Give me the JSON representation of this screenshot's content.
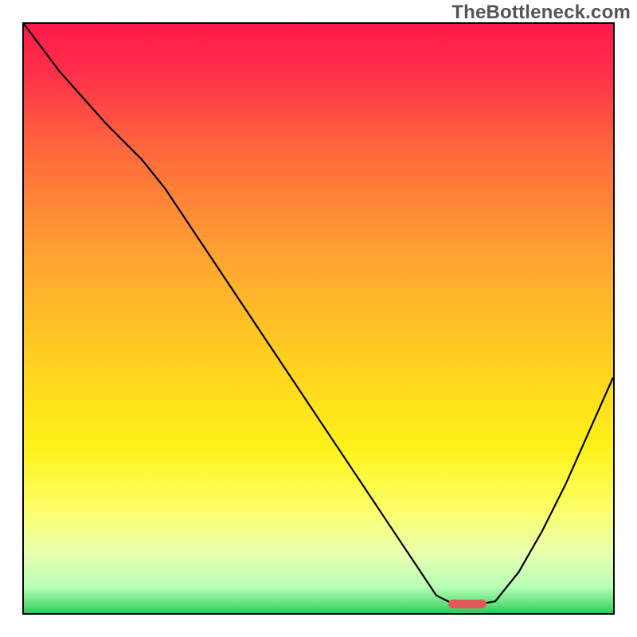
{
  "watermark": "TheBottleneck.com",
  "chart_data": {
    "type": "line",
    "title": "",
    "xlabel": "",
    "ylabel": "",
    "x_range": [
      0,
      100
    ],
    "y_range": [
      0,
      100
    ],
    "grid": false,
    "legend": false,
    "background_gradient_stops": [
      {
        "pos": 0.0,
        "color": "#ff1a4b"
      },
      {
        "pos": 0.08,
        "color": "#ff2e4a"
      },
      {
        "pos": 0.22,
        "color": "#ff6a3c"
      },
      {
        "pos": 0.4,
        "color": "#ffa531"
      },
      {
        "pos": 0.58,
        "color": "#ffd21f"
      },
      {
        "pos": 0.72,
        "color": "#fff21a"
      },
      {
        "pos": 0.82,
        "color": "#fcff66"
      },
      {
        "pos": 0.9,
        "color": "#e8ffb0"
      },
      {
        "pos": 0.955,
        "color": "#b8ffb8"
      },
      {
        "pos": 0.985,
        "color": "#5fe07a"
      },
      {
        "pos": 1.0,
        "color": "#2fc75a"
      }
    ],
    "series": [
      {
        "name": "bottleneck-curve",
        "color": "#000000",
        "stroke_width": 2.2,
        "x": [
          0.0,
          6.0,
          14.0,
          20.0,
          24.0,
          30.0,
          36.0,
          42.0,
          48.0,
          54.0,
          60.0,
          66.0,
          70.0,
          73.0,
          77.0,
          80.0,
          84.0,
          88.0,
          92.0,
          96.0,
          100.0
        ],
        "y": [
          100.0,
          92.0,
          83.0,
          77.0,
          72.0,
          63.0,
          54.0,
          45.0,
          36.0,
          27.0,
          18.0,
          9.0,
          3.0,
          1.5,
          1.5,
          2.0,
          7.0,
          14.0,
          22.0,
          31.0,
          40.0
        ]
      }
    ],
    "marker": {
      "name": "optimal-range",
      "color": "#e05a5a",
      "x_start": 72.0,
      "x_end": 78.5,
      "y": 1.6
    }
  }
}
